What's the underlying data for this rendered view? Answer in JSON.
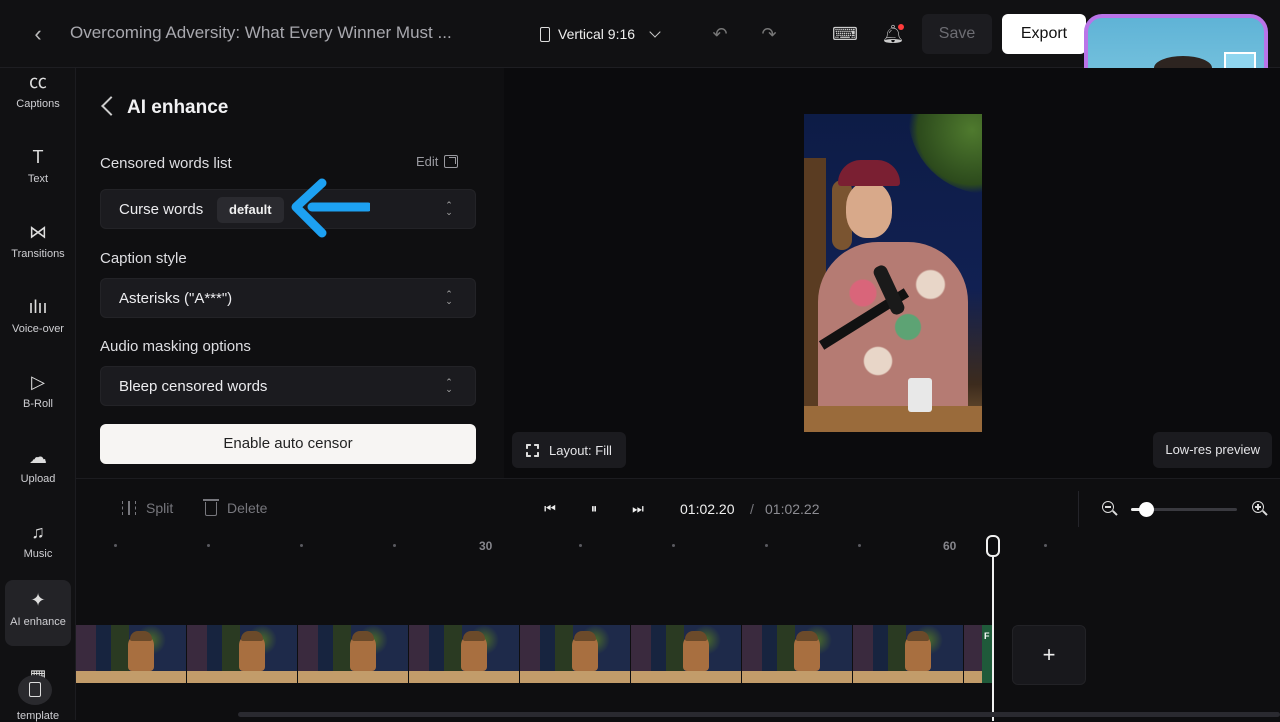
{
  "header": {
    "project_title": "Overcoming Adversity: What Every Winner Must ...",
    "aspect_ratio": "Vertical 9:16",
    "save_label": "Save",
    "export_label": "Export"
  },
  "sidebar": {
    "items": [
      {
        "label": "Captions",
        "icon": "captions-icon",
        "glyph": "㏄"
      },
      {
        "label": "Text",
        "icon": "text-icon",
        "glyph": "T"
      },
      {
        "label": "Transitions",
        "icon": "transitions-icon",
        "glyph": "⋈"
      },
      {
        "label": "Voice-over",
        "icon": "waveform-icon",
        "glyph": "ılıı"
      },
      {
        "label": "B-Roll",
        "icon": "broll-icon",
        "glyph": "▷"
      },
      {
        "label": "Upload",
        "icon": "upload-icon",
        "glyph": "☁"
      },
      {
        "label": "Music",
        "icon": "music-icon",
        "glyph": "♫"
      },
      {
        "label": "AI enhance",
        "icon": "sparkle-icon",
        "glyph": "✦"
      },
      {
        "label": "template",
        "icon": "template-icon",
        "glyph": "▦"
      }
    ],
    "active": "AI enhance"
  },
  "panel": {
    "title": "AI enhance",
    "censored_list_label": "Censored words list",
    "edit_label": "Edit",
    "censored_list_value": "Curse words",
    "censored_list_badge": "default",
    "caption_style_label": "Caption style",
    "caption_style_value": "Asterisks (\"A***\")",
    "audio_masking_label": "Audio masking options",
    "audio_masking_value": "Bleep censored words",
    "enable_button": "Enable auto censor"
  },
  "preview": {
    "layout_label": "Layout: Fill",
    "lowres_label": "Low-res preview"
  },
  "timeline": {
    "split_label": "Split",
    "delete_label": "Delete",
    "current_time": "01:02.20",
    "separator": "/",
    "total_time": "01:02.22",
    "ruler_labels": [
      "30",
      "60"
    ],
    "zoom_level": 0.14,
    "clip_end_marker": "F",
    "add_clip_label": "+"
  },
  "colors": {
    "accent_webcam_border": "#b974e8",
    "annotation_arrow": "#1da1f2",
    "notification_dot": "#ff3b3b"
  }
}
